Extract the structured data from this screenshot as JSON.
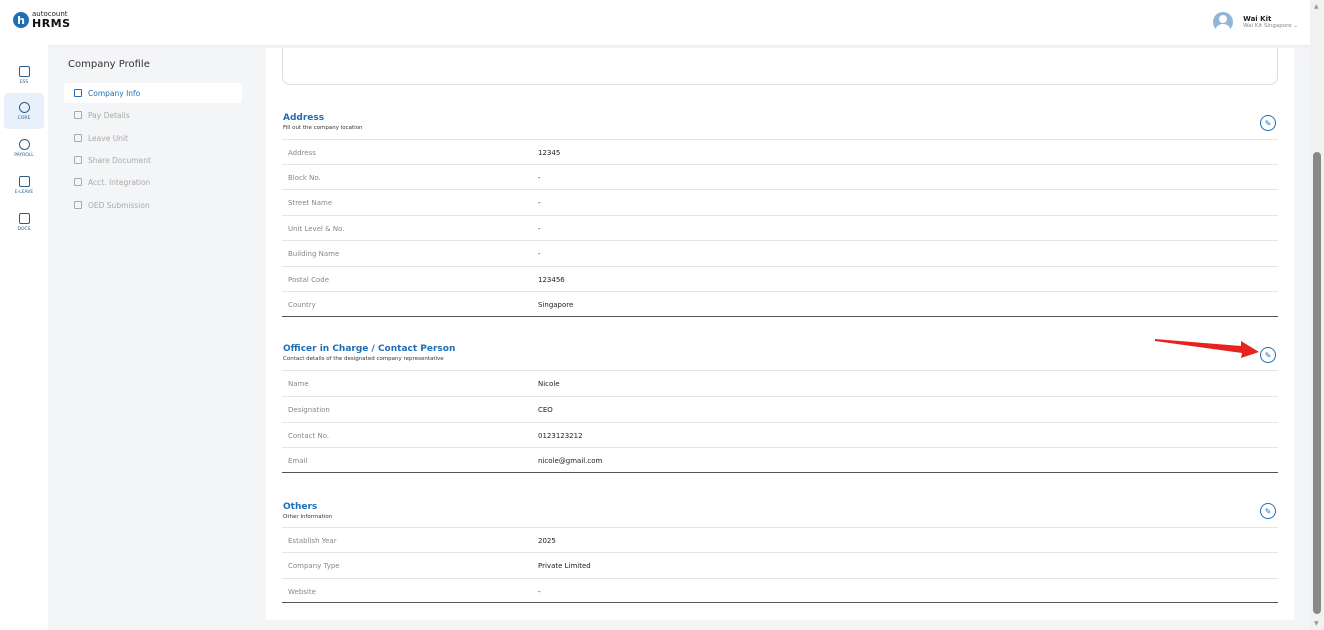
{
  "app": {
    "logo_letter": "h",
    "logo_top": "autocount",
    "logo_bottom": "HRMS"
  },
  "user": {
    "name": "Wai Kit",
    "company": "Wai Kit Singapore ⌄"
  },
  "rail": [
    {
      "label": "ESS",
      "icon": "ess-icon"
    },
    {
      "label": "CORE",
      "icon": "core-icon"
    },
    {
      "label": "PAYROLL",
      "icon": "payroll-icon"
    },
    {
      "label": "E-LEAVE",
      "icon": "calendar-icon"
    },
    {
      "label": "DOCS",
      "icon": "docs-icon"
    }
  ],
  "subnav": {
    "title": "Company Profile",
    "items": [
      {
        "label": "Company Info",
        "icon": "building-icon"
      },
      {
        "label": "Pay Details",
        "icon": "pay-icon"
      },
      {
        "label": "Leave Unit",
        "icon": "leave-icon"
      },
      {
        "label": "Share Document",
        "icon": "share-icon"
      },
      {
        "label": "Acct. Integration",
        "icon": "integration-icon"
      },
      {
        "label": "OED Submission",
        "icon": "submission-icon"
      }
    ]
  },
  "address": {
    "title": "Address",
    "subtitle": "Fill out the company location",
    "rows": [
      {
        "label": "Address",
        "value": "12345"
      },
      {
        "label": "Block No.",
        "value": "-"
      },
      {
        "label": "Street Name",
        "value": "-"
      },
      {
        "label": "Unit Level & No.",
        "value": "-"
      },
      {
        "label": "Building Name",
        "value": "-"
      },
      {
        "label": "Postal Code",
        "value": "123456"
      },
      {
        "label": "Country",
        "value": "Singapore"
      }
    ]
  },
  "officer": {
    "title": "Officer in Charge / Contact Person",
    "subtitle": "Contact details of the designated company representative",
    "rows": [
      {
        "label": "Name",
        "value": "Nicole"
      },
      {
        "label": "Designation",
        "value": "CEO"
      },
      {
        "label": "Contact No.",
        "value": "0123123212"
      },
      {
        "label": "Email",
        "value": "nicole@gmail.com"
      }
    ]
  },
  "others": {
    "title": "Others",
    "subtitle": "Other Information",
    "rows": [
      {
        "label": "Establish Year",
        "value": "2025"
      },
      {
        "label": "Company Type",
        "value": "Private Limited"
      },
      {
        "label": "Website",
        "value": "-"
      }
    ]
  },
  "colors": {
    "accent": "#1f6fb6",
    "annotation_arrow": "#e8231f"
  }
}
